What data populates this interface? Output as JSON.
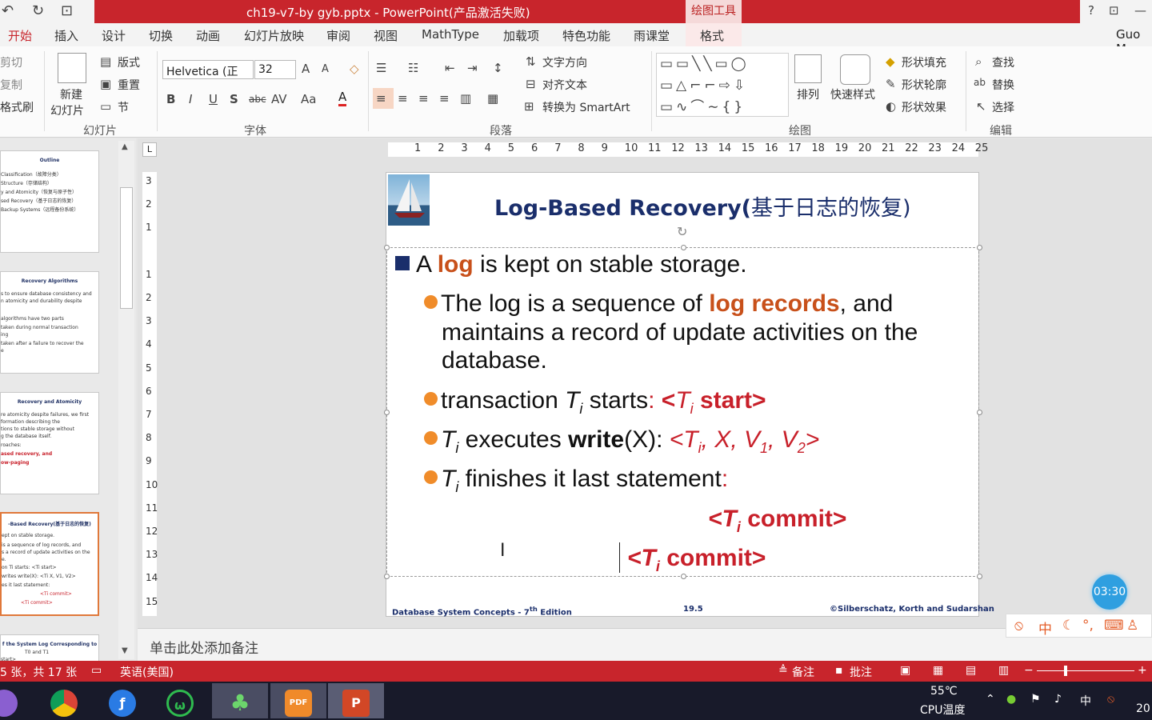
{
  "titlebar": {
    "document_title": "ch19-v7-by gyb.pptx - PowerPoint(产品激活失败)",
    "context_tab_group": "绘图工具",
    "help": "?"
  },
  "tabs": [
    "开始",
    "插入",
    "设计",
    "切换",
    "动画",
    "幻灯片放映",
    "审阅",
    "视图",
    "MathType",
    "加载项",
    "特色功能",
    "雨课堂",
    "格式"
  ],
  "user": "Guo M",
  "ribbon": {
    "clipboard": {
      "cut": "剪切",
      "copy": "复制",
      "format_painter": "格式刷"
    },
    "slides": {
      "new_slide": "新建",
      "new_slide2": "幻灯片",
      "layout": "版式",
      "reset": "重置",
      "section": "节",
      "label": "幻灯片"
    },
    "font": {
      "name": "Helvetica (正",
      "size": "32",
      "label": "字体"
    },
    "paragraph": {
      "text_direction": "文字方向",
      "align_text": "对齐文本",
      "convert_smartart": "转换为 SmartArt",
      "label": "段落"
    },
    "drawing": {
      "arrange": "排列",
      "quick_styles": "快速样式",
      "shape_fill": "形状填充",
      "shape_outline": "形状轮廓",
      "shape_effects": "形状效果",
      "label": "绘图"
    },
    "editing": {
      "find": "查找",
      "replace": "替换",
      "select": "选择",
      "label": "编辑"
    }
  },
  "thumbnails": [
    {
      "title": "Outline",
      "lines": [
        "Classification（故障分类）",
        "Structure（存储结构）",
        "y and Atomicity（恢复与原子性）",
        "sed Recovery（基于日志的恢复）",
        "Backup Systems（远程备份系统）"
      ]
    },
    {
      "title": "Recovery Algorithms",
      "lines": [
        "s to ensure database consistency and",
        "n atomicity and durability despite",
        "",
        "algorithms have two parts",
        "taken during normal transaction",
        "ing",
        "taken after a failure to recover the",
        "e"
      ]
    },
    {
      "title": "Recovery and Atomicity",
      "lines": [
        "re atomicity despite failures, we first",
        "formation describing the",
        "tions to stable storage without",
        "g the database itself.",
        "roaches:",
        "ased recovery, and",
        "ow-paging"
      ]
    },
    {
      "title": "-Based Recovery(基于日志的恢复)",
      "lines": [
        "ept on stable storage.",
        "is a sequence of log records, and",
        "s a record of update activities on the",
        "e.",
        "on Ti starts: <Ti start>",
        "writes write(X): <Ti X, V1, V2>",
        "es it last statement:",
        "<Ti commit>",
        "<Ti commit>"
      ]
    },
    {
      "title": "f the System Log Corresponding to",
      "lines": [
        "T0 and T1",
        "start>"
      ]
    }
  ],
  "slide": {
    "title_latin": "Log-Based Recovery(",
    "title_cjk": "基于日志的恢复)",
    "bullet1": {
      "pre": "A ",
      "hl": "log",
      "post": " is kept on stable storage."
    },
    "bullet2": {
      "pre": "The log is a sequence of ",
      "hl": "log records",
      "post": ", and",
      "line2": "maintains a record of update activities on the",
      "line3": "database."
    },
    "bullet3": {
      "pre": "transaction ",
      "T": "T",
      "sub": "i",
      "mid": " starts",
      "colon": ": ",
      "code_lt": "<",
      "codeT": "T",
      "codesub": "i",
      "code_rest": " start>"
    },
    "bullet4": {
      "T": "T",
      "sub": "i",
      "mid": " executes ",
      "write": "write",
      "x": "(X)",
      "colon": ": ",
      "code": "<T",
      "codesub": "i",
      "code_rest": ", X,  V",
      "v1sub": "1",
      "comma": ",  V",
      "v2sub": "2",
      "close": ">"
    },
    "bullet5": {
      "T": "T",
      "sub": "i",
      "rest": " finishes it last statement",
      "colon": ":"
    },
    "commit1": {
      "lt": "<T",
      "sub": "i",
      "rest": "  commit>"
    },
    "commit2": {
      "lt": "<T",
      "sub": "i",
      "rest": "  commit>"
    },
    "footer_left": "Database System Concepts - 7",
    "footer_left_sup": "th",
    "footer_left_end": " Edition",
    "footer_center": "19.5",
    "footer_right": "©Silberschatz, Korth and Sudarshan"
  },
  "hruler_ticks": [
    "1",
    "2",
    "3",
    "4",
    "5",
    "6",
    "7",
    "8",
    "9",
    "10",
    "11",
    "12",
    "13",
    "14",
    "15",
    "16",
    "17",
    "18",
    "19",
    "20",
    "21",
    "22",
    "23",
    "24",
    "25"
  ],
  "vruler_ticks": [
    "3",
    "2",
    "1",
    "",
    "1",
    "2",
    "3",
    "4",
    "5",
    "6",
    "7",
    "8",
    "9",
    "10",
    "11",
    "12",
    "13",
    "14",
    "15"
  ],
  "notes_placeholder": "单击此处添加备注",
  "status": {
    "slide_info": "5 张，共 17 张",
    "language": "英语(美国)",
    "notes": "备注",
    "comments": "批注"
  },
  "timer": "03:30",
  "taskbar": {
    "temp": "55℃",
    "temp_label": "CPU温度",
    "ime": "中",
    "clock": "20"
  },
  "colors": {
    "accent": "#c8252c",
    "title": "#1a2e6b",
    "highlight": "#c8501a",
    "code": "#c8202a",
    "bullet": "#f08c2a"
  }
}
